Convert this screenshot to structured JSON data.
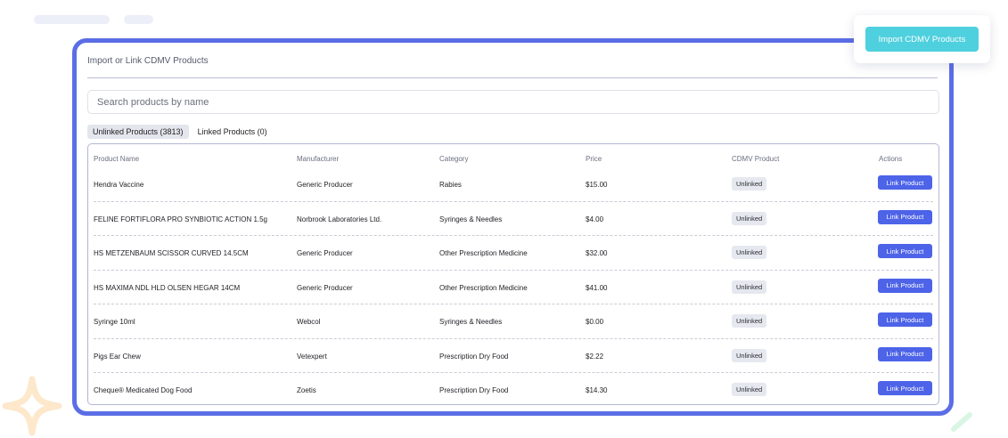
{
  "panel": {
    "title": "Import or Link CDMV Products",
    "search_placeholder": "Search products by name"
  },
  "tabs": [
    {
      "label": "Unlinked Products (3813)",
      "active": true
    },
    {
      "label": "Linked Products (0)",
      "active": false
    }
  ],
  "table": {
    "headers": [
      "Product Name",
      "Manufacturer",
      "Category",
      "Price",
      "CDMV Product",
      "Actions"
    ],
    "rows": [
      {
        "name": "Hendra Vaccine",
        "manufacturer": "Generic Producer",
        "category": "Rabies",
        "price": "$15.00",
        "status": "Unlinked",
        "action": "Link Product"
      },
      {
        "name": "FELINE FORTIFLORA PRO SYNBIOTIC ACTION 1.5g",
        "manufacturer": "Norbrook Laboratories Ltd.",
        "category": "Syringes & Needles",
        "price": "$4.00",
        "status": "Unlinked",
        "action": "Link Product"
      },
      {
        "name": "HS METZENBAUM SCISSOR CURVED 14.5CM",
        "manufacturer": "Generic Producer",
        "category": "Other Prescription Medicine",
        "price": "$32.00",
        "status": "Unlinked",
        "action": "Link Product"
      },
      {
        "name": "HS MAXIMA NDL HLD OLSEN HEGAR 14CM",
        "manufacturer": "Generic Producer",
        "category": "Other Prescription Medicine",
        "price": "$41.00",
        "status": "Unlinked",
        "action": "Link Product"
      },
      {
        "name": "Syringe 10ml",
        "manufacturer": "Webcol",
        "category": "Syringes & Needles",
        "price": "$0.00",
        "status": "Unlinked",
        "action": "Link Product"
      },
      {
        "name": "Pigs Ear Chew",
        "manufacturer": "Vetexpert",
        "category": "Prescription Dry Food",
        "price": "$2.22",
        "status": "Unlinked",
        "action": "Link Product"
      },
      {
        "name": "Cheque® Medicated Dog Food",
        "manufacturer": "Zoetis",
        "category": "Prescription Dry Food",
        "price": "$14.30",
        "status": "Unlinked",
        "action": "Link Product"
      }
    ]
  },
  "import_button": {
    "label": "Import CDMV Products"
  },
  "colors": {
    "panel_border": "#5b6ee6",
    "link_button": "#4d63e8",
    "import_button": "#4fd0de",
    "sparkle": "#fde8cc",
    "mint": "#d9f5e3"
  },
  "icons": [
    "sparkle-decoration-icon",
    "mint-stroke-decoration-icon"
  ]
}
